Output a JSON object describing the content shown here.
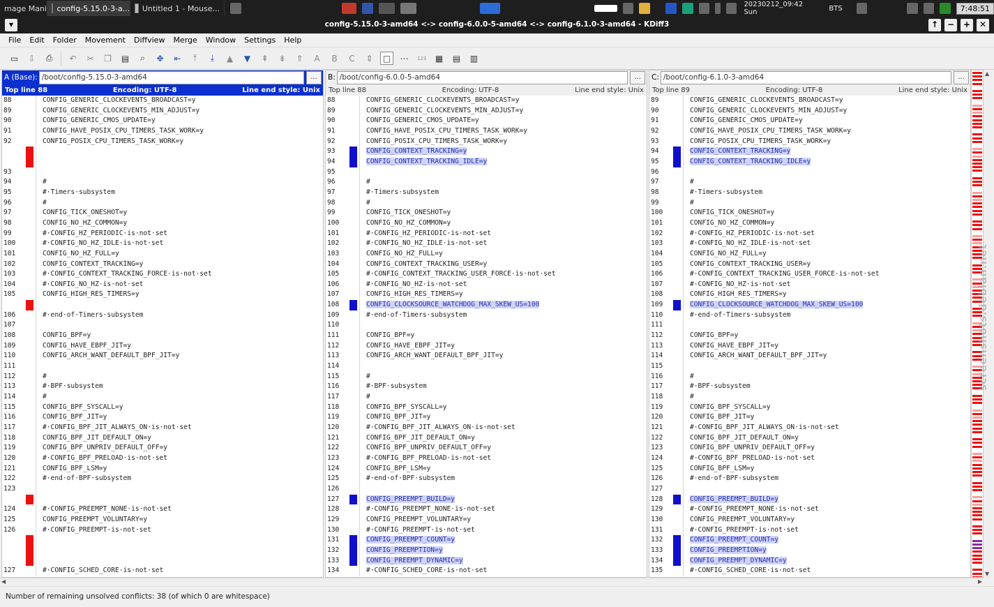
{
  "taskbar": {
    "tasks": [
      {
        "label": "mage Mani...",
        "active": false
      },
      {
        "label": "config-5.15.0-3-a...",
        "active": true
      },
      {
        "label": "Untitled 1 - Mouse...",
        "active": false
      }
    ],
    "datetime": "20230212_09:42 Sun",
    "bts": "BTS",
    "clock": "7:48:51"
  },
  "window": {
    "title": "config-5.15.0-3-amd64 <-> config-6.0.0-5-amd64 <-> config-6.1.0-3-amd64 - KDiff3",
    "buttons": [
      "↑",
      "−",
      "+",
      "✕"
    ]
  },
  "menu": [
    "File",
    "Edit",
    "Folder",
    "Movement",
    "Diffview",
    "Merge",
    "Window",
    "Settings",
    "Help"
  ],
  "panes": [
    {
      "label": "A (Base):",
      "path": "/boot/config-5.15.0-3-amd64",
      "top": "Top line 88",
      "enc": "Encoding: UTF-8",
      "eol": "Line end style: Unix",
      "lines": [
        {
          "n": "88",
          "t": "CONFIG_GENERIC_CLOCKEVENTS_BROADCAST=y",
          "m": ""
        },
        {
          "n": "89",
          "t": "CONFIG_GENERIC_CLOCKEVENTS_MIN_ADJUST=y",
          "m": ""
        },
        {
          "n": "90",
          "t": "CONFIG_GENERIC_CMOS_UPDATE=y",
          "m": ""
        },
        {
          "n": "91",
          "t": "CONFIG_HAVE_POSIX_CPU_TIMERS_TASK_WORK=y",
          "m": ""
        },
        {
          "n": "92",
          "t": "CONFIG_POSIX_CPU_TIMERS_TASK_WORK=y",
          "m": ""
        },
        {
          "n": "",
          "t": "",
          "m": "red"
        },
        {
          "n": "",
          "t": "",
          "m": "red"
        },
        {
          "n": "93",
          "t": "",
          "m": ""
        },
        {
          "n": "94",
          "t": "#",
          "m": ""
        },
        {
          "n": "95",
          "t": "#·Timers·subsystem",
          "m": ""
        },
        {
          "n": "96",
          "t": "#",
          "m": ""
        },
        {
          "n": "97",
          "t": "CONFIG_TICK_ONESHOT=y",
          "m": ""
        },
        {
          "n": "98",
          "t": "CONFIG_NO_HZ_COMMON=y",
          "m": ""
        },
        {
          "n": "99",
          "t": "#·CONFIG_HZ_PERIODIC·is·not·set",
          "m": ""
        },
        {
          "n": "100",
          "t": "#·CONFIG_NO_HZ_IDLE·is·not·set",
          "m": ""
        },
        {
          "n": "101",
          "t": "CONFIG_NO_HZ_FULL=y",
          "m": ""
        },
        {
          "n": "102",
          "t": "CONFIG_CONTEXT_TRACKING=y",
          "m": ""
        },
        {
          "n": "103",
          "t": "#·CONFIG_CONTEXT_TRACKING_FORCE·is·not·set",
          "m": ""
        },
        {
          "n": "104",
          "t": "#·CONFIG_NO_HZ·is·not·set",
          "m": ""
        },
        {
          "n": "105",
          "t": "CONFIG_HIGH_RES_TIMERS=y",
          "m": ""
        },
        {
          "n": "",
          "t": "",
          "m": "red"
        },
        {
          "n": "106",
          "t": "#·end·of·Timers·subsystem",
          "m": ""
        },
        {
          "n": "107",
          "t": "",
          "m": ""
        },
        {
          "n": "108",
          "t": "CONFIG_BPF=y",
          "m": ""
        },
        {
          "n": "109",
          "t": "CONFIG_HAVE_EBPF_JIT=y",
          "m": ""
        },
        {
          "n": "110",
          "t": "CONFIG_ARCH_WANT_DEFAULT_BPF_JIT=y",
          "m": ""
        },
        {
          "n": "111",
          "t": "",
          "m": ""
        },
        {
          "n": "112",
          "t": "#",
          "m": ""
        },
        {
          "n": "113",
          "t": "#·BPF·subsystem",
          "m": ""
        },
        {
          "n": "114",
          "t": "#",
          "m": ""
        },
        {
          "n": "115",
          "t": "CONFIG_BPF_SYSCALL=y",
          "m": ""
        },
        {
          "n": "116",
          "t": "CONFIG_BPF_JIT=y",
          "m": ""
        },
        {
          "n": "117",
          "t": "#·CONFIG_BPF_JIT_ALWAYS_ON·is·not·set",
          "m": ""
        },
        {
          "n": "118",
          "t": "CONFIG_BPF_JIT_DEFAULT_ON=y",
          "m": ""
        },
        {
          "n": "119",
          "t": "CONFIG_BPF_UNPRIV_DEFAULT_OFF=y",
          "m": ""
        },
        {
          "n": "120",
          "t": "#·CONFIG_BPF_PRELOAD·is·not·set",
          "m": ""
        },
        {
          "n": "121",
          "t": "CONFIG_BPF_LSM=y",
          "m": ""
        },
        {
          "n": "122",
          "t": "#·end·of·BPF·subsystem",
          "m": ""
        },
        {
          "n": "123",
          "t": "",
          "m": ""
        },
        {
          "n": "",
          "t": "",
          "m": "red"
        },
        {
          "n": "124",
          "t": "#·CONFIG_PREEMPT_NONE·is·not·set",
          "m": ""
        },
        {
          "n": "125",
          "t": "CONFIG_PREEMPT_VOLUNTARY=y",
          "m": ""
        },
        {
          "n": "126",
          "t": "#·CONFIG_PREEMPT·is·not·set",
          "m": ""
        },
        {
          "n": "",
          "t": "",
          "m": "red"
        },
        {
          "n": "",
          "t": "",
          "m": "red"
        },
        {
          "n": "",
          "t": "",
          "m": "red"
        },
        {
          "n": "127",
          "t": "#·CONFIG_SCHED_CORE·is·not·set",
          "m": ""
        }
      ]
    },
    {
      "label": "B:",
      "path": "/boot/config-6.0.0-5-amd64",
      "top": "Top line 88",
      "enc": "Encoding: UTF-8",
      "eol": "Line end style: Unix",
      "lines": [
        {
          "n": "88",
          "t": "CONFIG_GENERIC_CLOCKEVENTS_BROADCAST=y",
          "m": ""
        },
        {
          "n": "89",
          "t": "CONFIG_GENERIC_CLOCKEVENTS_MIN_ADJUST=y",
          "m": ""
        },
        {
          "n": "90",
          "t": "CONFIG_GENERIC_CMOS_UPDATE=y",
          "m": ""
        },
        {
          "n": "91",
          "t": "CONFIG_HAVE_POSIX_CPU_TIMERS_TASK_WORK=y",
          "m": ""
        },
        {
          "n": "92",
          "t": "CONFIG_POSIX_CPU_TIMERS_TASK_WORK=y",
          "m": ""
        },
        {
          "n": "93",
          "t": "CONFIG_CONTEXT_TRACKING=y",
          "m": "blue",
          "h": true
        },
        {
          "n": "94",
          "t": "CONFIG_CONTEXT_TRACKING_IDLE=y",
          "m": "blue",
          "h": true
        },
        {
          "n": "95",
          "t": "",
          "m": ""
        },
        {
          "n": "96",
          "t": "#",
          "m": ""
        },
        {
          "n": "97",
          "t": "#·Timers·subsystem",
          "m": ""
        },
        {
          "n": "98",
          "t": "#",
          "m": ""
        },
        {
          "n": "99",
          "t": "CONFIG_TICK_ONESHOT=y",
          "m": ""
        },
        {
          "n": "100",
          "t": "CONFIG_NO_HZ_COMMON=y",
          "m": ""
        },
        {
          "n": "101",
          "t": "#·CONFIG_HZ_PERIODIC·is·not·set",
          "m": ""
        },
        {
          "n": "102",
          "t": "#·CONFIG_NO_HZ_IDLE·is·not·set",
          "m": ""
        },
        {
          "n": "103",
          "t": "CONFIG_NO_HZ_FULL=y",
          "m": ""
        },
        {
          "n": "104",
          "t": "CONFIG_CONTEXT_TRACKING_USER=y",
          "m": ""
        },
        {
          "n": "105",
          "t": "#·CONFIG_CONTEXT_TRACKING_USER_FORCE·is·not·set",
          "m": ""
        },
        {
          "n": "106",
          "t": "#·CONFIG_NO_HZ·is·not·set",
          "m": ""
        },
        {
          "n": "107",
          "t": "CONFIG_HIGH_RES_TIMERS=y",
          "m": ""
        },
        {
          "n": "108",
          "t": "CONFIG_CLOCKSOURCE_WATCHDOG_MAX_SKEW_US=100",
          "m": "blue",
          "h": true
        },
        {
          "n": "109",
          "t": "#·end·of·Timers·subsystem",
          "m": ""
        },
        {
          "n": "110",
          "t": "",
          "m": ""
        },
        {
          "n": "111",
          "t": "CONFIG_BPF=y",
          "m": ""
        },
        {
          "n": "112",
          "t": "CONFIG_HAVE_EBPF_JIT=y",
          "m": ""
        },
        {
          "n": "113",
          "t": "CONFIG_ARCH_WANT_DEFAULT_BPF_JIT=y",
          "m": ""
        },
        {
          "n": "114",
          "t": "",
          "m": ""
        },
        {
          "n": "115",
          "t": "#",
          "m": ""
        },
        {
          "n": "116",
          "t": "#·BPF·subsystem",
          "m": ""
        },
        {
          "n": "117",
          "t": "#",
          "m": ""
        },
        {
          "n": "118",
          "t": "CONFIG_BPF_SYSCALL=y",
          "m": ""
        },
        {
          "n": "119",
          "t": "CONFIG_BPF_JIT=y",
          "m": ""
        },
        {
          "n": "120",
          "t": "#·CONFIG_BPF_JIT_ALWAYS_ON·is·not·set",
          "m": ""
        },
        {
          "n": "121",
          "t": "CONFIG_BPF_JIT_DEFAULT_ON=y",
          "m": ""
        },
        {
          "n": "122",
          "t": "CONFIG_BPF_UNPRIV_DEFAULT_OFF=y",
          "m": ""
        },
        {
          "n": "123",
          "t": "#·CONFIG_BPF_PRELOAD·is·not·set",
          "m": ""
        },
        {
          "n": "124",
          "t": "CONFIG_BPF_LSM=y",
          "m": ""
        },
        {
          "n": "125",
          "t": "#·end·of·BPF·subsystem",
          "m": ""
        },
        {
          "n": "126",
          "t": "",
          "m": ""
        },
        {
          "n": "127",
          "t": "CONFIG_PREEMPT_BUILD=y",
          "m": "blue",
          "h": true
        },
        {
          "n": "128",
          "t": "#·CONFIG_PREEMPT_NONE·is·not·set",
          "m": ""
        },
        {
          "n": "129",
          "t": "CONFIG_PREEMPT_VOLUNTARY=y",
          "m": ""
        },
        {
          "n": "130",
          "t": "#·CONFIG_PREEMPT·is·not·set",
          "m": ""
        },
        {
          "n": "131",
          "t": "CONFIG_PREEMPT_COUNT=y",
          "m": "blue",
          "h": true
        },
        {
          "n": "132",
          "t": "CONFIG_PREEMPTION=y",
          "m": "blue",
          "h": true
        },
        {
          "n": "133",
          "t": "CONFIG_PREEMPT_DYNAMIC=y",
          "m": "blue",
          "h": true
        },
        {
          "n": "134",
          "t": "#·CONFIG_SCHED_CORE·is·not·set",
          "m": ""
        }
      ]
    },
    {
      "label": "C:",
      "path": "/boot/config-6.1.0-3-amd64",
      "top": "Top line 89",
      "enc": "Encoding: UTF-8",
      "eol": "Line end style: Unix",
      "lines": [
        {
          "n": "89",
          "t": "CONFIG_GENERIC_CLOCKEVENTS_BROADCAST=y",
          "m": ""
        },
        {
          "n": "90",
          "t": "CONFIG_GENERIC_CLOCKEVENTS_MIN_ADJUST=y",
          "m": ""
        },
        {
          "n": "91",
          "t": "CONFIG_GENERIC_CMOS_UPDATE=y",
          "m": ""
        },
        {
          "n": "92",
          "t": "CONFIG_HAVE_POSIX_CPU_TIMERS_TASK_WORK=y",
          "m": ""
        },
        {
          "n": "93",
          "t": "CONFIG_POSIX_CPU_TIMERS_TASK_WORK=y",
          "m": ""
        },
        {
          "n": "94",
          "t": "CONFIG_CONTEXT_TRACKING=y",
          "m": "blue",
          "h": true
        },
        {
          "n": "95",
          "t": "CONFIG_CONTEXT_TRACKING_IDLE=y",
          "m": "blue",
          "h": true
        },
        {
          "n": "96",
          "t": "",
          "m": ""
        },
        {
          "n": "97",
          "t": "#",
          "m": ""
        },
        {
          "n": "98",
          "t": "#·Timers·subsystem",
          "m": ""
        },
        {
          "n": "99",
          "t": "#",
          "m": ""
        },
        {
          "n": "100",
          "t": "CONFIG_TICK_ONESHOT=y",
          "m": ""
        },
        {
          "n": "101",
          "t": "CONFIG_NO_HZ_COMMON=y",
          "m": ""
        },
        {
          "n": "102",
          "t": "#·CONFIG_HZ_PERIODIC·is·not·set",
          "m": ""
        },
        {
          "n": "103",
          "t": "#·CONFIG_NO_HZ_IDLE·is·not·set",
          "m": ""
        },
        {
          "n": "104",
          "t": "CONFIG_NO_HZ_FULL=y",
          "m": ""
        },
        {
          "n": "105",
          "t": "CONFIG_CONTEXT_TRACKING_USER=y",
          "m": ""
        },
        {
          "n": "106",
          "t": "#·CONFIG_CONTEXT_TRACKING_USER_FORCE·is·not·set",
          "m": ""
        },
        {
          "n": "107",
          "t": "#·CONFIG_NO_HZ·is·not·set",
          "m": ""
        },
        {
          "n": "108",
          "t": "CONFIG_HIGH_RES_TIMERS=y",
          "m": ""
        },
        {
          "n": "109",
          "t": "CONFIG_CLOCKSOURCE_WATCHDOG_MAX_SKEW_US=100",
          "m": "blue",
          "h": true
        },
        {
          "n": "110",
          "t": "#·end·of·Timers·subsystem",
          "m": ""
        },
        {
          "n": "111",
          "t": "",
          "m": ""
        },
        {
          "n": "112",
          "t": "CONFIG_BPF=y",
          "m": ""
        },
        {
          "n": "113",
          "t": "CONFIG_HAVE_EBPF_JIT=y",
          "m": ""
        },
        {
          "n": "114",
          "t": "CONFIG_ARCH_WANT_DEFAULT_BPF_JIT=y",
          "m": ""
        },
        {
          "n": "115",
          "t": "",
          "m": ""
        },
        {
          "n": "116",
          "t": "#",
          "m": ""
        },
        {
          "n": "117",
          "t": "#·BPF·subsystem",
          "m": ""
        },
        {
          "n": "118",
          "t": "#",
          "m": ""
        },
        {
          "n": "119",
          "t": "CONFIG_BPF_SYSCALL=y",
          "m": ""
        },
        {
          "n": "120",
          "t": "CONFIG_BPF_JIT=y",
          "m": ""
        },
        {
          "n": "121",
          "t": "#·CONFIG_BPF_JIT_ALWAYS_ON·is·not·set",
          "m": ""
        },
        {
          "n": "122",
          "t": "CONFIG_BPF_JIT_DEFAULT_ON=y",
          "m": ""
        },
        {
          "n": "123",
          "t": "CONFIG_BPF_UNPRIV_DEFAULT_OFF=y",
          "m": ""
        },
        {
          "n": "124",
          "t": "#·CONFIG_BPF_PRELOAD·is·not·set",
          "m": ""
        },
        {
          "n": "125",
          "t": "CONFIG_BPF_LSM=y",
          "m": ""
        },
        {
          "n": "126",
          "t": "#·end·of·BPF·subsystem",
          "m": ""
        },
        {
          "n": "127",
          "t": "",
          "m": ""
        },
        {
          "n": "128",
          "t": "CONFIG_PREEMPT_BUILD=y",
          "m": "blue",
          "h": true
        },
        {
          "n": "129",
          "t": "#·CONFIG_PREEMPT_NONE·is·not·set",
          "m": ""
        },
        {
          "n": "130",
          "t": "CONFIG_PREEMPT_VOLUNTARY=y",
          "m": ""
        },
        {
          "n": "131",
          "t": "#·CONFIG_PREEMPT·is·not·set",
          "m": ""
        },
        {
          "n": "132",
          "t": "CONFIG_PREEMPT_COUNT=y",
          "m": "blue",
          "h": true
        },
        {
          "n": "133",
          "t": "CONFIG_PREEMPTION=y",
          "m": "blue",
          "h": true
        },
        {
          "n": "134",
          "t": "CONFIG_PREEMPT_DYNAMIC=y",
          "m": "blue",
          "h": true
        },
        {
          "n": "135",
          "t": "#·CONFIG_SCHED_CORE·is·not·set",
          "m": ""
        }
      ]
    }
  ],
  "status": "Number of remaining unsolved conflicts: 38 (of which 0 are whitespace)",
  "watermark": "screenshots.debian.net",
  "colors": {
    "conflict": "#ec1010",
    "change": "#1010cc",
    "base_header": "#0b2fd0"
  }
}
